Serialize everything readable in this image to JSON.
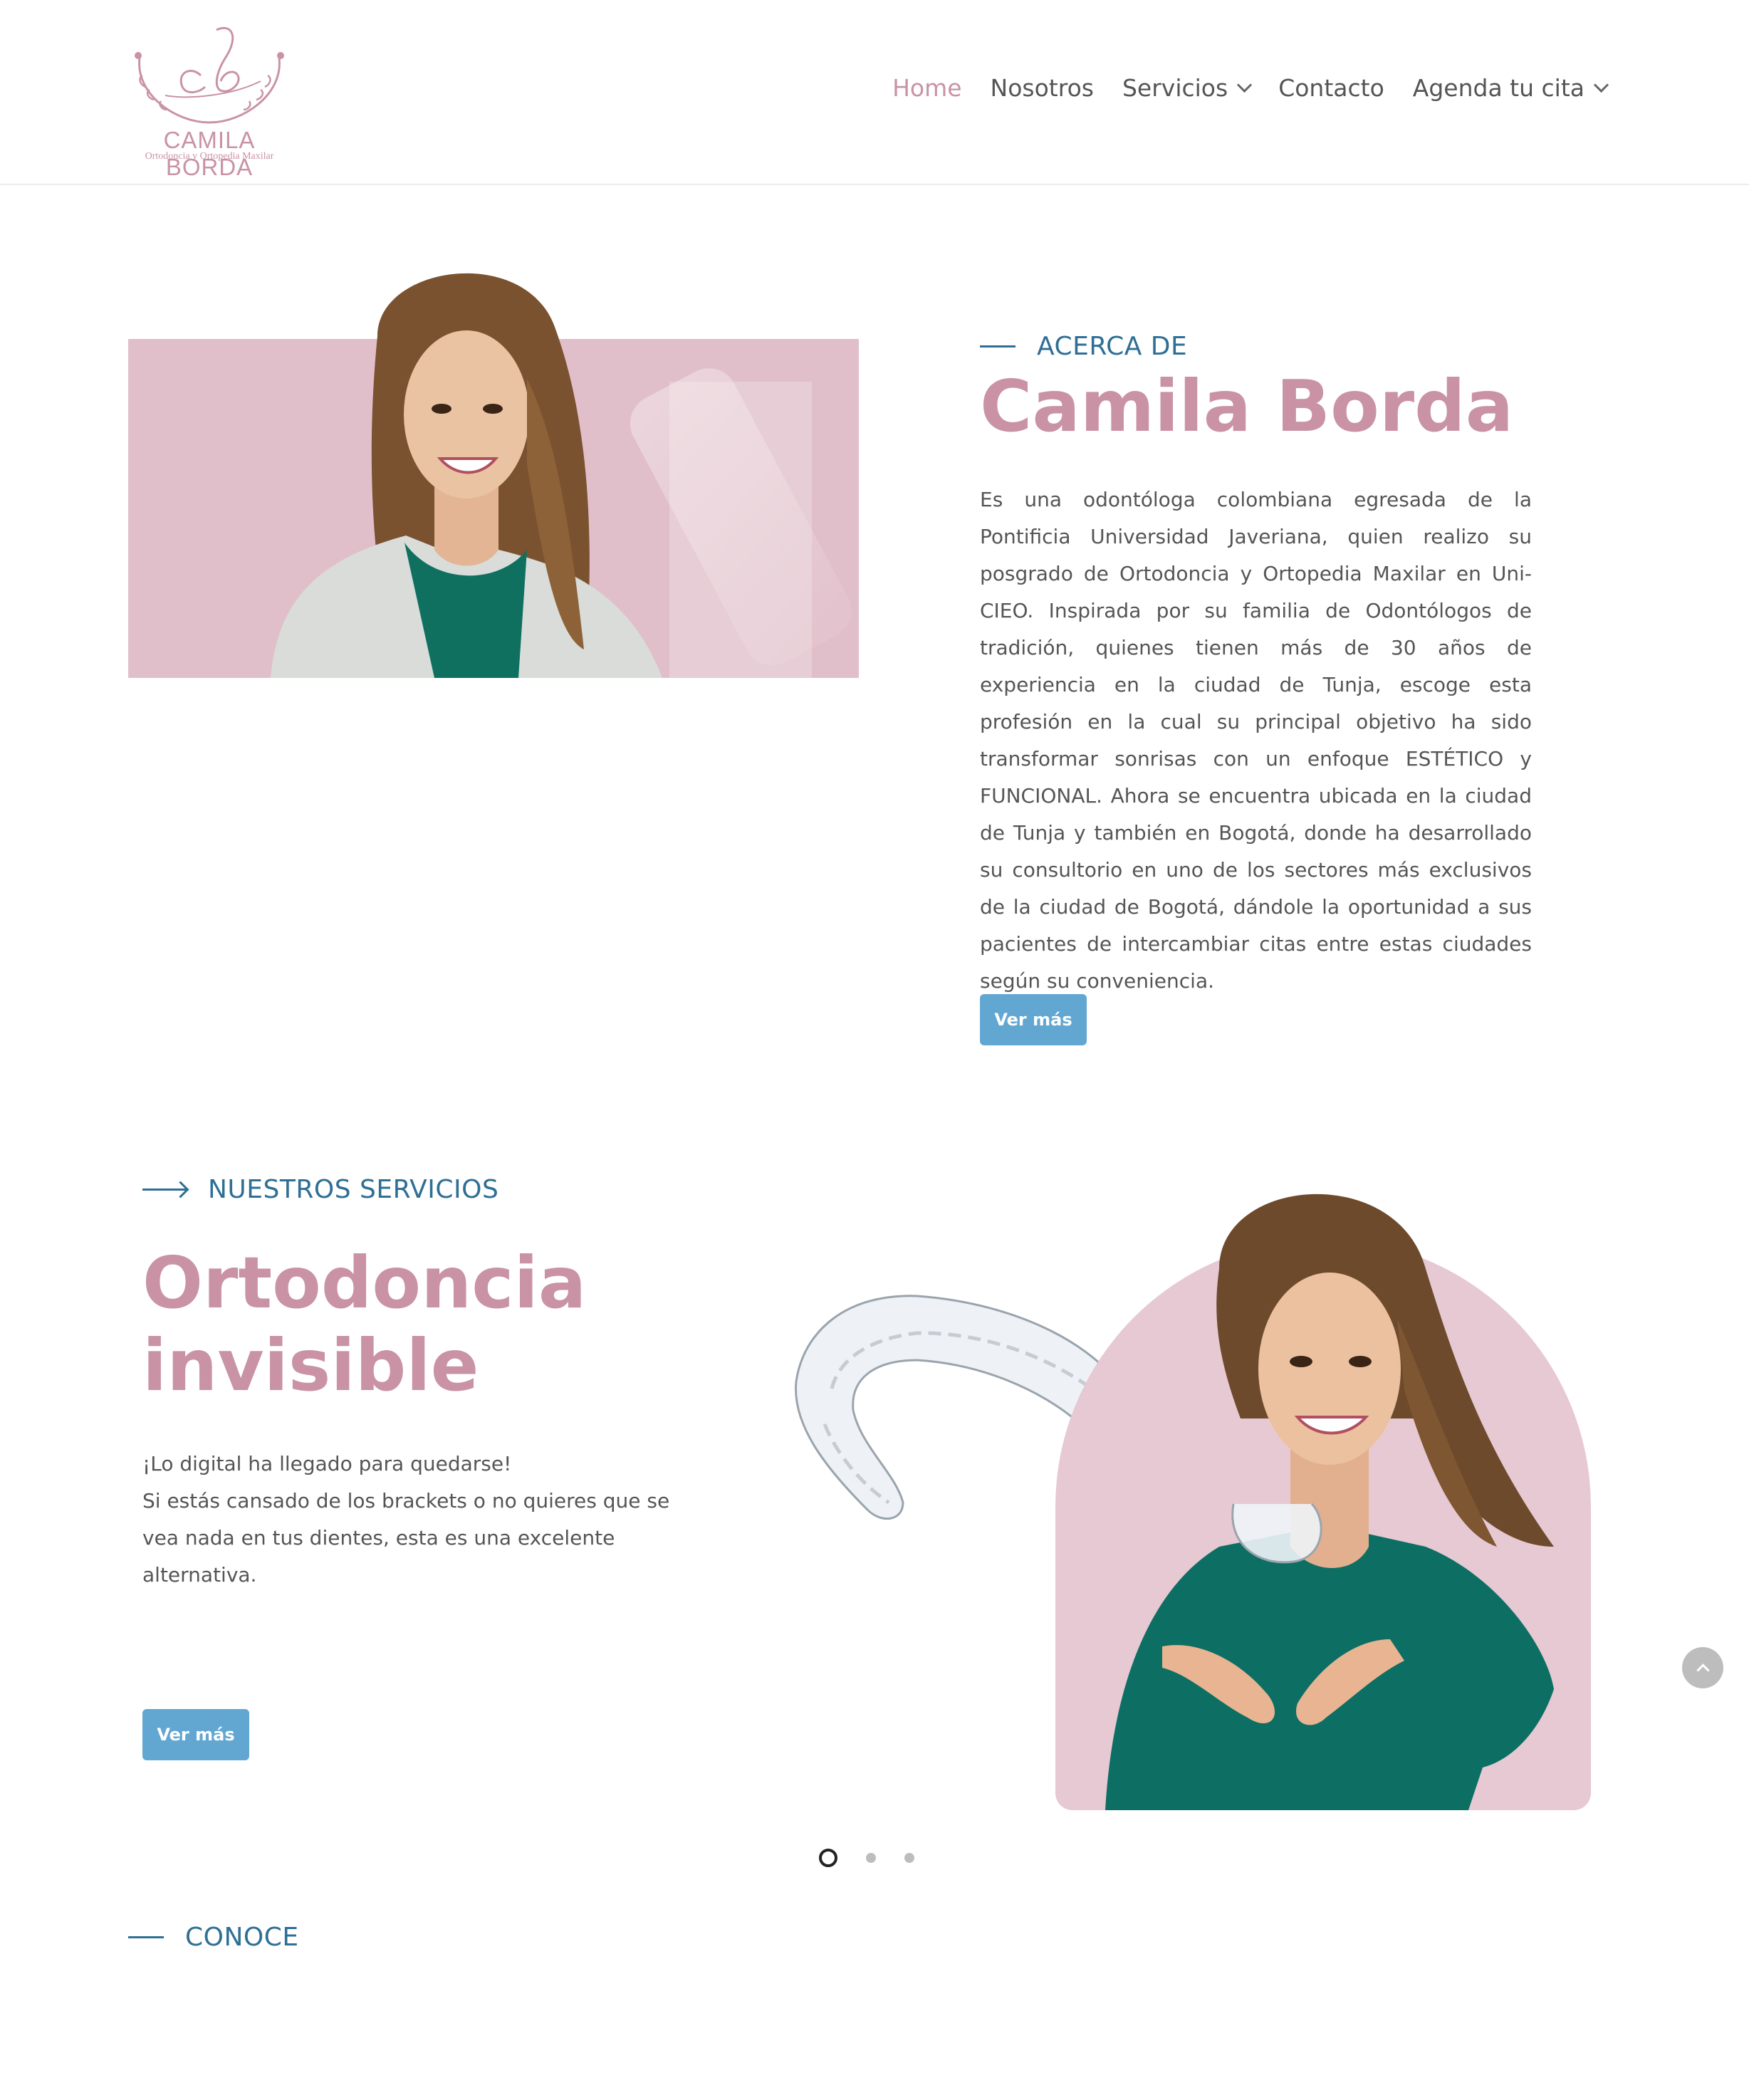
{
  "brand": {
    "monogram": "cb",
    "name": "CAMILA BORDA",
    "tagline": "Ortodoncia y Ortopedia Maxilar",
    "color": "#c993a5"
  },
  "nav": {
    "items": [
      {
        "label": "Home",
        "active": true,
        "dropdown": false
      },
      {
        "label": "Nosotros",
        "active": false,
        "dropdown": false
      },
      {
        "label": "Servicios",
        "active": false,
        "dropdown": true
      },
      {
        "label": "Contacto",
        "active": false,
        "dropdown": false
      },
      {
        "label": "Agenda tu cita",
        "active": false,
        "dropdown": true
      }
    ]
  },
  "about": {
    "eyebrow": "ACERCA DE",
    "title": "Camila Borda",
    "text": "Es una odontóloga colombiana egresada de la Pontificia Universidad Javeriana, quien realizo su posgrado de Ortodoncia y Ortopedia Maxilar en Uni-CIEO. Inspirada por su familia de Odontólogos de tradición, quienes tienen más de 30 años de experiencia en la ciudad de Tunja, escoge esta profesión en la cual su principal objetivo ha sido transformar sonrisas con un enfoque ESTÉTICO y FUNCIONAL. Ahora se encuentra ubicada en la ciudad de Tunja y también en Bogotá, donde ha desarrollado su consultorio en uno de los sectores más exclusivos de la ciudad de Bogotá, dándole la oportunidad a sus pacientes de intercambiar citas entre estas ciudades según su conveniencia.",
    "button": "Ver más"
  },
  "services": {
    "eyebrow": "NUESTROS SERVICIOS",
    "title_line1": "Ortodoncia",
    "title_line2": "invisible",
    "text_line1": "¡Lo digital ha llegado para quedarse!",
    "text_line2": "Si estás cansado de los brackets o no quieres que se vea nada en tus dientes, esta es una excelente alternativa.",
    "button": "Ver más",
    "slide_count": 3,
    "active_slide": 1
  },
  "conoce": {
    "eyebrow": "CONOCE"
  },
  "colors": {
    "accent_pink": "#c993a5",
    "heading_blue": "#2e6f95",
    "button_blue": "#62a7d2",
    "pink_bg": "#e1bfca"
  },
  "icons": {
    "scroll_top": "chevron-up-icon",
    "dropdown": "chevron-down-icon"
  }
}
